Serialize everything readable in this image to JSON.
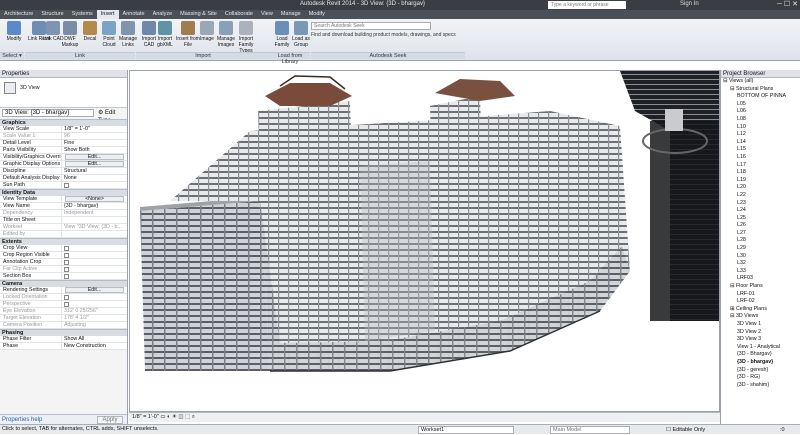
{
  "window": {
    "title": "Autodesk Revit 2014 -  3D View: {3D - bhargav}",
    "search_placeholder": "Type a keyword or phrase",
    "sign_in": "Sign In"
  },
  "tabs": [
    "Architecture",
    "Structure",
    "Systems",
    "Insert",
    "Annotate",
    "Analyze",
    "Massing & Site",
    "Collaborate",
    "View",
    "Manage",
    "Modify"
  ],
  "active_tab": "Insert",
  "ribbon": {
    "buttons": [
      {
        "label": "Modify",
        "color": "#5b8ac9"
      },
      {
        "label": "Link Revit",
        "color": "#6d8db8"
      },
      {
        "label": "Link CAD",
        "color": "#7f94b0"
      },
      {
        "label": "DWF Markup",
        "color": "#7c8ca5"
      },
      {
        "label": "Decal",
        "color": "#b28a4a"
      },
      {
        "label": "Point Cloud",
        "color": "#7aa3c8"
      },
      {
        "label": "Manage Links",
        "color": "#8094ab"
      },
      {
        "label": "Import CAD",
        "color": "#6f87a8"
      },
      {
        "label": "Import gbXML",
        "color": "#5f93a6"
      },
      {
        "label": "Insert from File",
        "color": "#a07c4e"
      },
      {
        "label": "Image",
        "color": "#9aa7b5"
      },
      {
        "label": "Manage Images",
        "color": "#8aa0b8"
      },
      {
        "label": "Import Family Types",
        "color": "#a9b2bd"
      },
      {
        "label": "Load Family",
        "color": "#6b8fb9"
      },
      {
        "label": "Load as Group",
        "color": "#7c96b6"
      }
    ],
    "groups": [
      "Select ▾",
      "Link",
      "Import",
      "Load from Library",
      "Autodesk Seek"
    ],
    "seek_input": "Search Autodesk Seek",
    "seek_desc": "Find and download building product models, drawings, and specs"
  },
  "properties": {
    "title": "Properties",
    "type_name": "3D View",
    "view_selector": "3D View: {3D - bhargav}",
    "edit_type": "Edit Type",
    "sections": [
      {
        "name": "Graphics",
        "rows": [
          {
            "k": "View Scale",
            "v": "1/8\" = 1'-0\""
          },
          {
            "k": "Scale Value    1:",
            "v": "96",
            "dis": true
          },
          {
            "k": "Detail Level",
            "v": "Fine"
          },
          {
            "k": "Parts Visibility",
            "v": "Show Both"
          },
          {
            "k": "Visibility/Graphics Overri...",
            "btn": "Edit..."
          },
          {
            "k": "Graphic Display Options",
            "btn": "Edit..."
          },
          {
            "k": "Discipline",
            "v": "Structural"
          },
          {
            "k": "Default Analysis Display ...",
            "v": "None"
          },
          {
            "k": "Sun Path",
            "chk": true
          }
        ]
      },
      {
        "name": "Identity Data",
        "rows": [
          {
            "k": "View Template",
            "btn": "<None>"
          },
          {
            "k": "View Name",
            "v": "{3D - bhargav}"
          },
          {
            "k": "Dependency",
            "v": "Independent",
            "dis": true
          },
          {
            "k": "Title on Sheet",
            "v": ""
          },
          {
            "k": "Workset",
            "v": "View \"3D View: {3D - b...",
            "dis": true
          },
          {
            "k": "Edited by",
            "v": "",
            "dis": true
          }
        ]
      },
      {
        "name": "Extents",
        "rows": [
          {
            "k": "Crop View",
            "chk": true
          },
          {
            "k": "Crop Region Visible",
            "chk": true
          },
          {
            "k": "Annotation Crop",
            "chk": true
          },
          {
            "k": "Far Clip Active",
            "chk": true,
            "dis": true
          },
          {
            "k": "Section Box",
            "chk": true
          }
        ]
      },
      {
        "name": "Camera",
        "rows": [
          {
            "k": "Rendering Settings",
            "btn": "Edit..."
          },
          {
            "k": "Locked Orientation",
            "chk": true,
            "dis": true
          },
          {
            "k": "Perspective",
            "chk": true,
            "dis": true
          },
          {
            "k": "Eye Elevation",
            "v": "312' 0 25/256\"",
            "dis": true
          },
          {
            "k": "Target Elevation",
            "v": "178' 4 1/2\"",
            "dis": true
          },
          {
            "k": "Camera Position",
            "v": "Adjusting",
            "dis": true
          }
        ]
      },
      {
        "name": "Phasing",
        "rows": [
          {
            "k": "Phase Filter",
            "v": "Show All"
          },
          {
            "k": "Phase",
            "v": "New Construction"
          }
        ]
      }
    ],
    "help": "Properties help",
    "apply": "Apply"
  },
  "browser": {
    "title": "Project Browser",
    "nodes": [
      {
        "t": "Views (all)",
        "d": 0,
        "x": "⊟"
      },
      {
        "t": "Structural Plans",
        "d": 1,
        "x": "⊟"
      },
      {
        "t": "BOTTOM OF PINNA",
        "d": 2
      },
      {
        "t": "L05",
        "d": 2
      },
      {
        "t": "L06",
        "d": 2
      },
      {
        "t": "L08",
        "d": 2
      },
      {
        "t": "L10",
        "d": 2
      },
      {
        "t": "L12",
        "d": 2
      },
      {
        "t": "L14",
        "d": 2
      },
      {
        "t": "L15",
        "d": 2
      },
      {
        "t": "L16",
        "d": 2
      },
      {
        "t": "L17",
        "d": 2
      },
      {
        "t": "L18",
        "d": 2
      },
      {
        "t": "L19",
        "d": 2
      },
      {
        "t": "L20",
        "d": 2
      },
      {
        "t": "L22",
        "d": 2
      },
      {
        "t": "L23",
        "d": 2
      },
      {
        "t": "L24",
        "d": 2
      },
      {
        "t": "L25",
        "d": 2
      },
      {
        "t": "L26",
        "d": 2
      },
      {
        "t": "L27",
        "d": 2
      },
      {
        "t": "L28",
        "d": 2
      },
      {
        "t": "L29",
        "d": 2
      },
      {
        "t": "L30",
        "d": 2
      },
      {
        "t": "L32",
        "d": 2
      },
      {
        "t": "L33",
        "d": 2
      },
      {
        "t": "LRF03",
        "d": 2
      },
      {
        "t": "Floor Plans",
        "d": 1,
        "x": "⊟"
      },
      {
        "t": "LRF-01",
        "d": 2
      },
      {
        "t": "LRF-02",
        "d": 2
      },
      {
        "t": "Ceiling Plans",
        "d": 1,
        "x": "⊞"
      },
      {
        "t": "3D Views",
        "d": 1,
        "x": "⊟"
      },
      {
        "t": "3D View 1",
        "d": 2
      },
      {
        "t": "3D View 2",
        "d": 2
      },
      {
        "t": "3D View 3",
        "d": 2
      },
      {
        "t": "View 1 - Analytical",
        "d": 2
      },
      {
        "t": "{3D - Bhargav}",
        "d": 2
      },
      {
        "t": "{3D - bhargav}",
        "d": 2,
        "b": true
      },
      {
        "t": "{3D - geresh}",
        "d": 2
      },
      {
        "t": "{3D - RG}",
        "d": 2
      },
      {
        "t": "{3D - shahim}",
        "d": 2
      }
    ]
  },
  "viewbar": {
    "scale": "1/8\" = 1'-0\""
  },
  "status": {
    "hint": "Click to select, TAB for alternates, CTRL adds, SHIFT unselects.",
    "workset": "Workset1",
    "model": "Main Model",
    "editable": "Editable Only",
    "filter": ":0"
  }
}
